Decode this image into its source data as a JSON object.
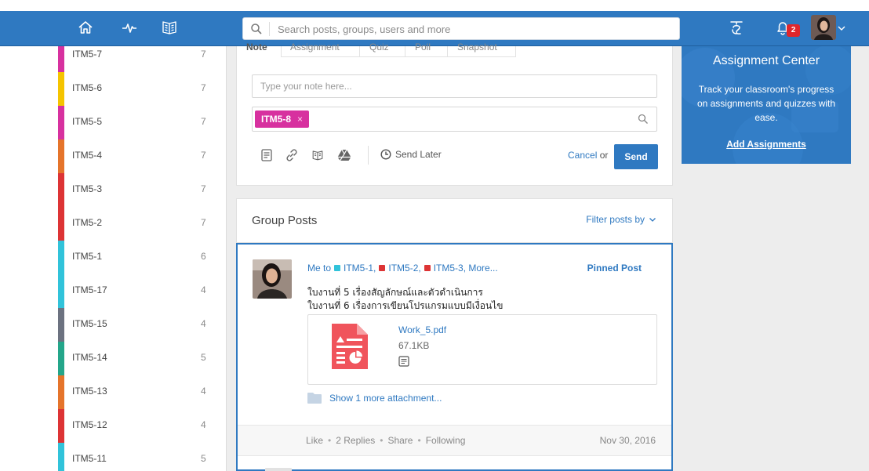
{
  "header": {
    "search_placeholder": "Search posts, groups, users and more",
    "notification_count": "2",
    "brand_color": "#2f79c1"
  },
  "sidebar": {
    "items": [
      {
        "name": "ITM5-7",
        "count": "7",
        "color": "#d7319f"
      },
      {
        "name": "ITM5-6",
        "count": "7",
        "color": "#f5c400"
      },
      {
        "name": "ITM5-5",
        "count": "7",
        "color": "#d7319f"
      },
      {
        "name": "ITM5-4",
        "count": "7",
        "color": "#e5742b"
      },
      {
        "name": "ITM5-3",
        "count": "7",
        "color": "#dd3435"
      },
      {
        "name": "ITM5-2",
        "count": "7",
        "color": "#dd3435"
      },
      {
        "name": "ITM5-1",
        "count": "6",
        "color": "#31c3da"
      },
      {
        "name": "ITM5-17",
        "count": "4",
        "color": "#31c3da"
      },
      {
        "name": "ITM5-15",
        "count": "4",
        "color": "#6c7280"
      },
      {
        "name": "ITM5-14",
        "count": "5",
        "color": "#24a68a"
      },
      {
        "name": "ITM5-13",
        "count": "4",
        "color": "#e5742b"
      },
      {
        "name": "ITM5-12",
        "count": "4",
        "color": "#dd3435"
      },
      {
        "name": "ITM5-11",
        "count": "5",
        "color": "#31c3da"
      }
    ]
  },
  "composer": {
    "tabs": [
      "Note",
      "Assignment",
      "Quiz",
      "Poll",
      "Snapshot"
    ],
    "note_placeholder": "Type your note here...",
    "recipient": "ITM5-8",
    "recipient_remove": "×",
    "send_later": "Send Later",
    "cancel": "Cancel",
    "or": "or",
    "send": "Send"
  },
  "group_posts": {
    "title": "Group Posts",
    "filter": "Filter posts by"
  },
  "post": {
    "from": "Me to",
    "recipients": [
      {
        "name": "ITM5-1,",
        "color": "#31c3da"
      },
      {
        "name": "ITM5-2,",
        "color": "#dd3435"
      },
      {
        "name": "ITM5-3, More...",
        "color": "#dd3435"
      }
    ],
    "pinned": "Pinned Post",
    "body_line1": "ใบงานที่ 5 เรื่องสัญลักษณ์และตัวดำเนินการ",
    "body_line2": "ใบงานที่ 6 เรื่องการเขียนโปรแกรมแบบมีเงื่อนไข",
    "attachment_name": "Work_5.pdf",
    "attachment_size": "67.1KB",
    "more_attachments": "Show 1 more attachment...",
    "actions": [
      "Like",
      "2 Replies",
      "Share",
      "Following"
    ],
    "date": "Nov 30, 2016"
  },
  "assignment_center": {
    "title": "Assignment Center",
    "text": "Track your classroom's progress on assignments and quizzes with ease.",
    "link": "Add Assignments"
  }
}
